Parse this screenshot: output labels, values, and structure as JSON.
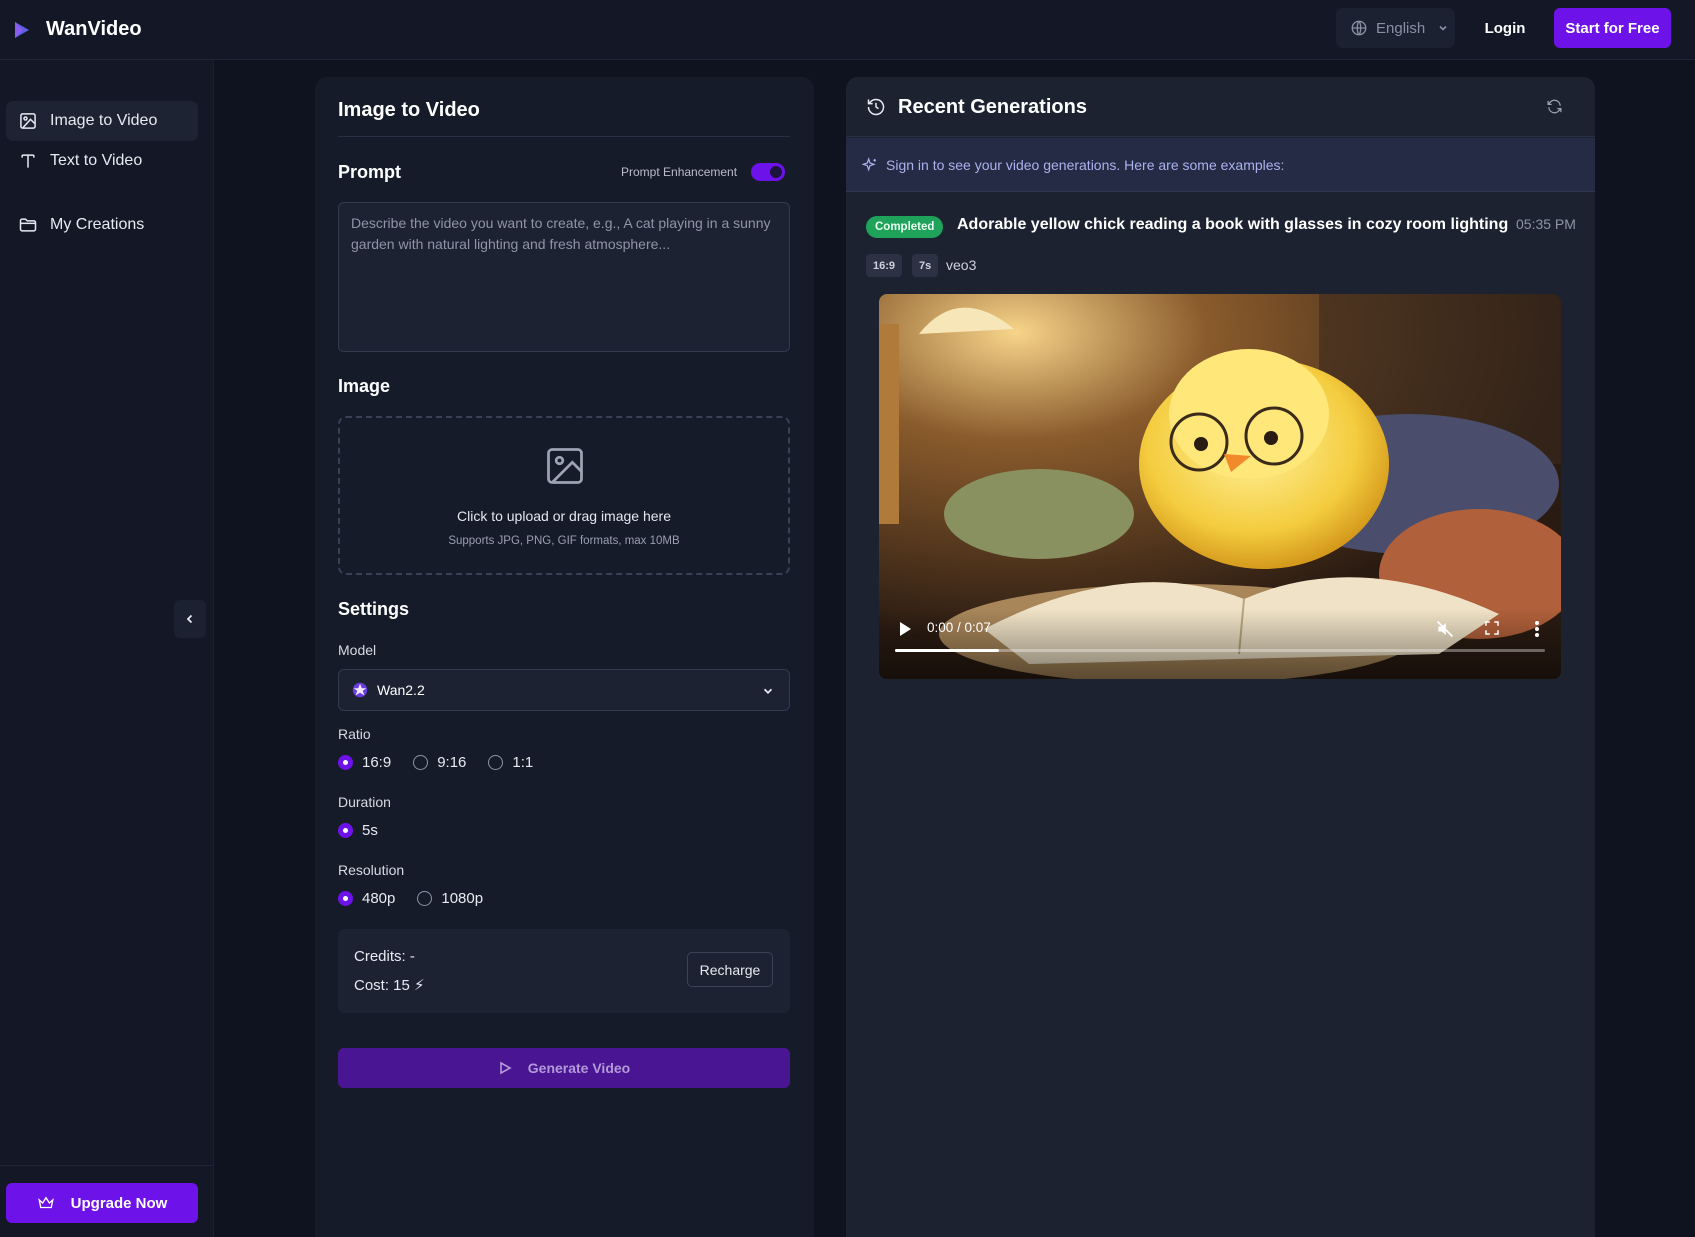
{
  "header": {
    "brand": "WanVideo",
    "language": "English",
    "login": "Login",
    "start": "Start for Free"
  },
  "sidebar": {
    "items": [
      {
        "label": "Image to Video",
        "icon": "image-icon",
        "active": true
      },
      {
        "label": "Text to Video",
        "icon": "text-icon",
        "active": false
      },
      {
        "label": "My Creations",
        "icon": "folder-icon",
        "active": false
      }
    ],
    "upgrade": "Upgrade Now"
  },
  "form": {
    "title": "Image to Video",
    "prompt_heading": "Prompt",
    "prompt_enhancement": "Prompt Enhancement",
    "prompt_enhancement_on": true,
    "prompt_placeholder": "Describe the video you want to create, e.g., A cat playing in a sunny garden with natural lighting and fresh atmosphere...",
    "prompt_value": "",
    "image_heading": "Image",
    "upload_main": "Click to upload or drag image here",
    "upload_sub": "Supports JPG, PNG, GIF formats, max 10MB",
    "settings_heading": "Settings",
    "model_label": "Model",
    "model_value": "Wan2.2",
    "ratio_label": "Ratio",
    "ratio_options": [
      "16:9",
      "9:16",
      "1:1"
    ],
    "ratio_selected": "16:9",
    "duration_label": "Duration",
    "duration_options": [
      "5s"
    ],
    "duration_selected": "5s",
    "resolution_label": "Resolution",
    "resolution_options": [
      "480p",
      "1080p"
    ],
    "resolution_selected": "480p",
    "credits": "Credits: -",
    "cost": "Cost: 15 ⚡",
    "recharge": "Recharge",
    "generate": "Generate Video"
  },
  "recent": {
    "title": "Recent Generations",
    "notice": "Sign in to see your video generations. Here are some examples:",
    "items": [
      {
        "status": "Completed",
        "title": "Adorable yellow chick reading a book with glasses in cozy room lighting",
        "time": "05:35 PM",
        "ratio": "16:9",
        "duration": "7s",
        "model": "veo3",
        "player_time": "0:00 / 0:07",
        "progress": 0.16
      }
    ]
  },
  "colors": {
    "accent": "#6d12e8",
    "background": "#0f1320",
    "panel": "#161b29",
    "success": "#1fa25a"
  }
}
